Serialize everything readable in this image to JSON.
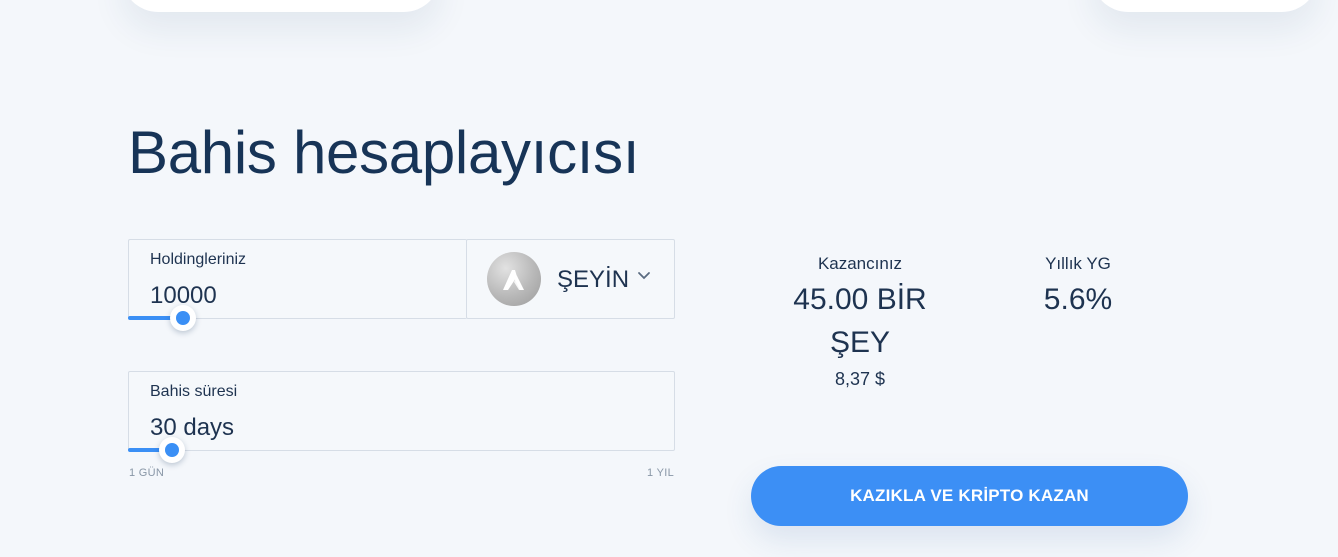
{
  "calculator": {
    "title": "Bahis hesaplayıcısı",
    "holdings": {
      "label": "Holdingleriniz",
      "value": "10000",
      "slider_fraction": 0.1
    },
    "currency": {
      "name": "ŞEYİN",
      "icon": "algorand-coin-icon"
    },
    "duration": {
      "label": "Bahis süresi",
      "value": "30 days",
      "slider_fraction": 0.08,
      "min_label": "1 GÜN",
      "max_label": "1 YIL"
    }
  },
  "results": {
    "earnings_label": "Kazancınız",
    "earnings_value": "45.00 BİR ŞEY",
    "earnings_usd": "8,37 $",
    "apy_label": "Yıllık YG",
    "apy_value": "5.6%"
  },
  "cta": {
    "label": "KAZIKLA VE KRİPTO KAZAN"
  },
  "colors": {
    "accent": "#3c8ff5",
    "title": "#173457",
    "background": "#f4f7fb"
  }
}
